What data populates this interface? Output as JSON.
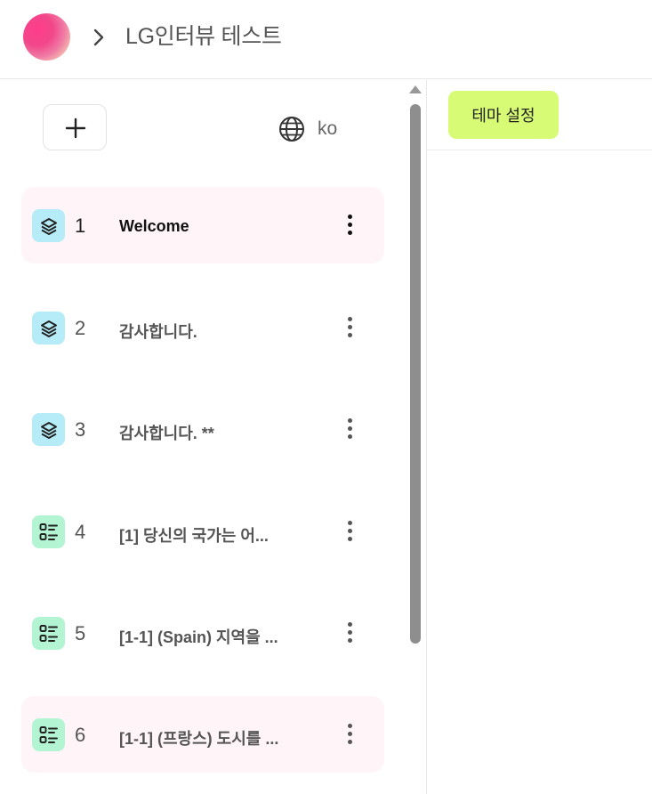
{
  "header": {
    "breadcrumb_separator_icon": "chevron-right-icon",
    "project_title": "LG인터뷰 테스트"
  },
  "toolbar": {
    "add_icon": "plus-icon",
    "language_icon": "globe-icon",
    "language_label": "ko"
  },
  "steps": [
    {
      "number": "1",
      "title": "Welcome",
      "icon": "layers-icon",
      "icon_color": "#b5ecf7",
      "active": true
    },
    {
      "number": "2",
      "title": "감사합니다.",
      "icon": "layers-icon",
      "icon_color": "#b5ecf7"
    },
    {
      "number": "3",
      "title": "감사합니다. **",
      "icon": "layers-icon",
      "icon_color": "#b5ecf7"
    },
    {
      "number": "4",
      "title": "[1] 당신의 국가는 어...",
      "icon": "list-icon",
      "icon_color": "#b3f5d2"
    },
    {
      "number": "5",
      "title": "[1-1] (Spain) 지역을 ...",
      "icon": "list-icon",
      "icon_color": "#b3f5d2"
    },
    {
      "number": "6",
      "title": "[1-1] (프랑스) 도시를 ...",
      "icon": "list-icon",
      "icon_color": "#b3f5d2",
      "highlighted": true
    }
  ],
  "main": {
    "theme_button_label": "테마 설정"
  },
  "colors": {
    "accent_button": "#d7fb74",
    "highlight_row": "#fff5f9"
  }
}
